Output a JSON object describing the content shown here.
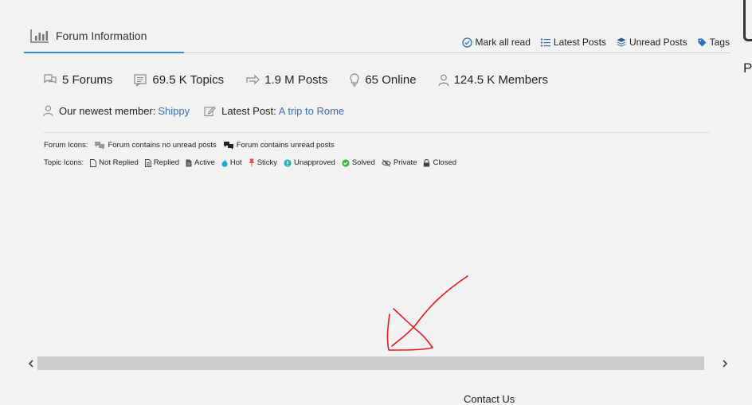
{
  "header": {
    "title": "Forum Information"
  },
  "toolbar": {
    "mark_all_read": "Mark all read",
    "latest_posts": "Latest Posts",
    "unread_posts": "Unread Posts",
    "tags": "Tags"
  },
  "stats": {
    "forums": "5 Forums",
    "topics": "69.5 K Topics",
    "posts": "1.9 M Posts",
    "online": "65 Online",
    "members": "124.5 K Members"
  },
  "meta": {
    "newest_label": "Our newest member:",
    "newest_name": "Shippy",
    "latest_label": "Latest Post:",
    "latest_title": "A trip to Rome"
  },
  "forum_icons": {
    "label": "Forum Icons:",
    "no_unread": "Forum contains no unread posts",
    "unread": "Forum contains unread posts"
  },
  "topic_icons": {
    "label": "Topic Icons:",
    "not_replied": "Not Replied",
    "replied": "Replied",
    "active": "Active",
    "hot": "Hot",
    "sticky": "Sticky",
    "unapproved": "Unapproved",
    "solved": "Solved",
    "private": "Private",
    "closed": "Closed"
  },
  "footer": {
    "contact": "Contact Us"
  },
  "edge": {
    "letter": "P"
  },
  "colors": {
    "accent": "#3a8ad0",
    "link": "#3b6ea8",
    "annotation": "#e01a1a",
    "hot": "#1aa6d6",
    "sticky": "#e0505a",
    "unapproved": "#2bb3b3",
    "solved": "#3ab54a"
  }
}
